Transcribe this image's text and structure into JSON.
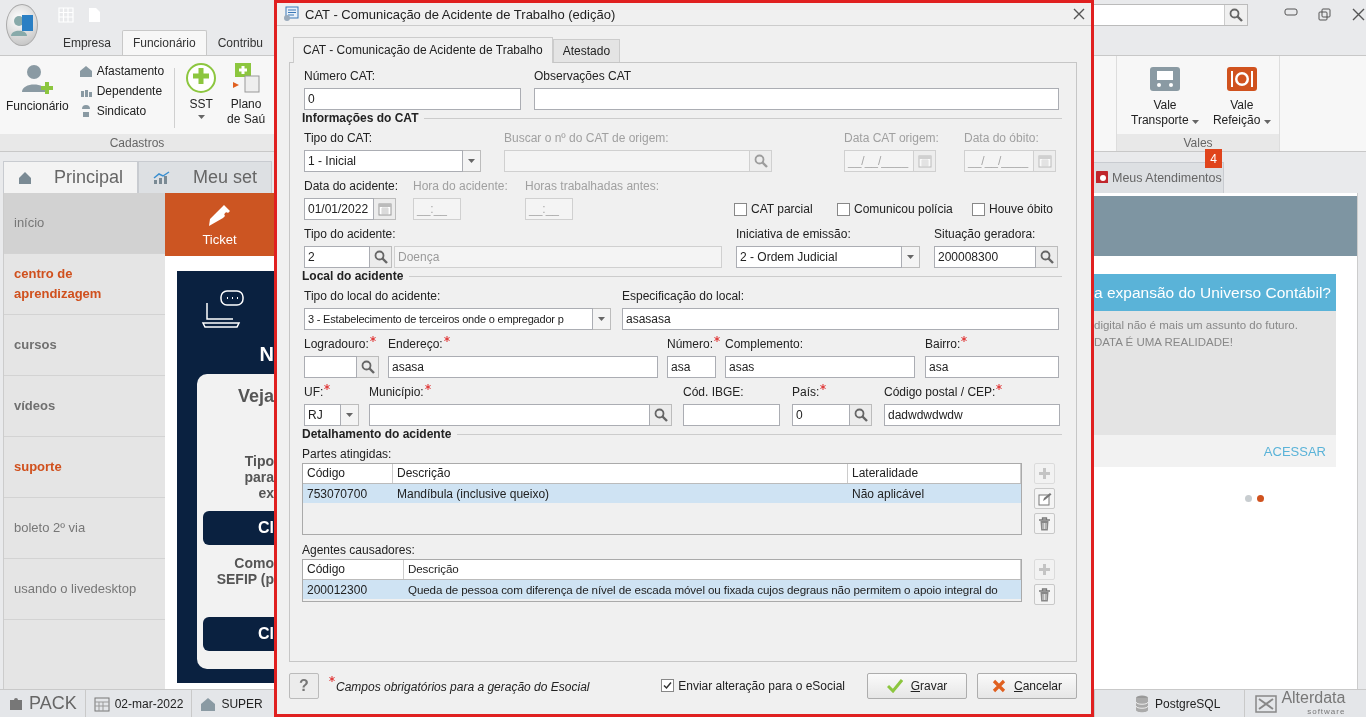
{
  "left": {
    "ribbon_tabs": [
      {
        "label": "Empresa",
        "selected": false
      },
      {
        "label": "Funcionário",
        "selected": true
      },
      {
        "label": "Contribu",
        "selected": false
      }
    ],
    "ribbon": {
      "main": "Funcionário",
      "small_items": [
        "Afastamento",
        "Dependente",
        "Sindicato"
      ],
      "sst": "SST",
      "plan_lines": [
        "Plano",
        "de Saú"
      ],
      "group": "Cadastros"
    },
    "page_tabs": [
      {
        "label": "Principal",
        "selected": true
      },
      {
        "label": "Meu set",
        "selected": false
      }
    ],
    "sidebar": [
      {
        "label": "início",
        "selected": true
      },
      {
        "label": "centro de aprendizagem",
        "selected": false
      },
      {
        "label": "cursos",
        "selected": false
      },
      {
        "label": "vídeos",
        "selected": false
      },
      {
        "label": "suporte",
        "selected": false
      },
      {
        "label": "boleto 2º via",
        "selected": false
      },
      {
        "label": "usando o livedesktop",
        "selected": false
      }
    ],
    "ticket": "Ticket",
    "promo": {
      "heading": "N",
      "card_title": "Veja",
      "lines": [
        "Tipo",
        "para",
        "ex"
      ],
      "button1": "Cl",
      "lines2": [
        "Como",
        "SEFIP (p"
      ],
      "button2": "Cl"
    },
    "status": {
      "logo": "PACK",
      "date": "02-mar-2022",
      "company": "SUPER"
    }
  },
  "dialog": {
    "title": "CAT - Comunicação de Acidente de Trabalho (edição)",
    "tabs": [
      {
        "label": "CAT - Comunicação de Acidente de Trabalho",
        "selected": true
      },
      {
        "label": "Atestado",
        "selected": false
      }
    ],
    "form": [
      {
        "kind": "row",
        "fields": [
          {
            "kind": "text",
            "label": "Número CAT:",
            "value": "0",
            "disabled": false
          },
          {
            "kind": "text",
            "label": "Observações CAT",
            "disabled": false
          }
        ]
      },
      {
        "kind": "section",
        "title": "Informações do CAT"
      },
      {
        "kind": "row",
        "fields": [
          {
            "kind": "combo",
            "label": "Tipo do CAT:",
            "value": "1 - Inicial",
            "disabled": false
          },
          {
            "kind": "lookup",
            "label": "Buscar o nº do CAT de origem:",
            "disabled": true
          },
          {
            "kind": "date",
            "label": "Data CAT origem:",
            "placeholder": "__/__/____",
            "disabled": true
          },
          {
            "kind": "date",
            "label": "Data do óbito:",
            "placeholder": "__/__/____",
            "disabled": true
          }
        ]
      },
      {
        "kind": "row",
        "fields": [
          {
            "kind": "date",
            "label": "Data do acidente:",
            "value": "01/01/2022",
            "disabled": false
          },
          {
            "kind": "text",
            "label": "Hora do acidente:",
            "placeholder": "__:__",
            "disabled": true
          },
          {
            "kind": "text",
            "label": "Horas trabalhadas antes:",
            "placeholder": "__:__",
            "disabled": true
          },
          {
            "kind": "checkbox",
            "label": "CAT parcial",
            "checked": false
          },
          {
            "kind": "checkbox",
            "label": "Comunicou polícia",
            "checked": false
          },
          {
            "kind": "checkbox",
            "label": "Houve óbito",
            "checked": false
          }
        ]
      },
      {
        "kind": "row",
        "fields": [
          {
            "kind": "lookup_desc",
            "label": "Tipo do acidente:",
            "value": "2",
            "description": "Doença",
            "disabled": false
          },
          {
            "kind": "combo",
            "label": "Iniciativa de emissão:",
            "value": "2 - Ordem Judicial",
            "disabled": false
          },
          {
            "kind": "lookup",
            "label": "Situação geradora:",
            "value": "200008300",
            "disabled": false
          }
        ]
      },
      {
        "kind": "section",
        "title": "Local do acidente"
      },
      {
        "kind": "row",
        "fields": [
          {
            "kind": "combo",
            "label": "Tipo do local do acidente:",
            "value": "3 - Estabelecimento de terceiros onde o empregador p",
            "disabled": false
          },
          {
            "kind": "text",
            "label": "Especificação do local:",
            "value": "asasasa",
            "disabled": false
          }
        ]
      },
      {
        "kind": "row",
        "fields": [
          {
            "kind": "lookup",
            "label": "Logradouro:",
            "disabled": false,
            "required": true
          },
          {
            "kind": "text",
            "label": "Endereço:",
            "value": "asasa",
            "disabled": false,
            "required": true
          },
          {
            "kind": "text",
            "label": "Número:",
            "value": "asa",
            "disabled": false,
            "required": true
          },
          {
            "kind": "text",
            "label": "Complemento:",
            "value": "asas",
            "disabled": false
          },
          {
            "kind": "text",
            "label": "Bairro:",
            "value": "asa",
            "disabled": false,
            "required": true
          }
        ]
      },
      {
        "kind": "row",
        "fields": [
          {
            "kind": "combo",
            "label": "UF:",
            "value": "RJ",
            "disabled": false,
            "required": true
          },
          {
            "kind": "lookup",
            "label": "Município:",
            "disabled": false,
            "required": true
          },
          {
            "kind": "text",
            "label": "Cód. IBGE:",
            "disabled": false
          },
          {
            "kind": "lookup",
            "label": "País:",
            "value": "0",
            "disabled": false,
            "required": true
          },
          {
            "kind": "text",
            "label": "Código postal / CEP:",
            "value": "dadwdwdwdw",
            "disabled": false,
            "required": true
          }
        ]
      },
      {
        "kind": "section",
        "title": "Detalhamento do acidente"
      },
      {
        "kind": "grid",
        "label": "Partes atingidas:",
        "columns": [
          "Código",
          "Descrição",
          "Lateralidade"
        ],
        "rows": [
          {
            "cells": [
              "753070700",
              "Mandíbula (inclusive queixo)",
              "Não aplicável"
            ],
            "selected": true
          }
        ],
        "actions": [
          {
            "kind": "add",
            "disabled": true
          },
          {
            "kind": "edit",
            "disabled": false
          },
          {
            "kind": "delete",
            "disabled": false
          }
        ]
      },
      {
        "kind": "grid",
        "label": "Agentes causadores:",
        "columns": [
          "Código",
          "Descrição"
        ],
        "rows": [
          {
            "cells": [
              "200012300",
              "Queda de pessoa com diferença de nível de escada móvel ou fixada cujos degraus não permitem o apoio integral do"
            ],
            "selected": true
          }
        ],
        "actions": [
          {
            "kind": "add",
            "disabled": true
          },
          {
            "kind": "delete",
            "disabled": false
          }
        ]
      }
    ],
    "footer": {
      "help": "?",
      "note": "Campos obrigatórios para a geração do Esocial",
      "note_required": true,
      "send": {
        "label": "Enviar alteração para o eSocial",
        "checked": true
      },
      "buttons": [
        {
          "kind": "save",
          "label": "Gravar"
        },
        {
          "kind": "cancel",
          "label": "Cancelar"
        }
      ]
    }
  },
  "right": {
    "ribbon": {
      "buttons": [
        {
          "line1": "Vale",
          "line2": "Transporte",
          "kind": "bus"
        },
        {
          "line1": "Vale",
          "line2": "Refeição",
          "kind": "meal"
        }
      ],
      "group": "Vales"
    },
    "tab": {
      "label": "Meus Atendimentos",
      "badge": "4"
    },
    "card": {
      "title": "a expansão do Universo Contábil?",
      "lines": [
        "digital não é mais um assunto do futuro.",
        "DATA É UMA REALIDADE!"
      ],
      "link": "ACESSAR"
    },
    "dots": [
      {
        "selected": false
      },
      {
        "selected": true
      }
    ],
    "status": {
      "db": "PostgreSQL",
      "logo": "Alterdata",
      "logo_sub": "software"
    }
  }
}
